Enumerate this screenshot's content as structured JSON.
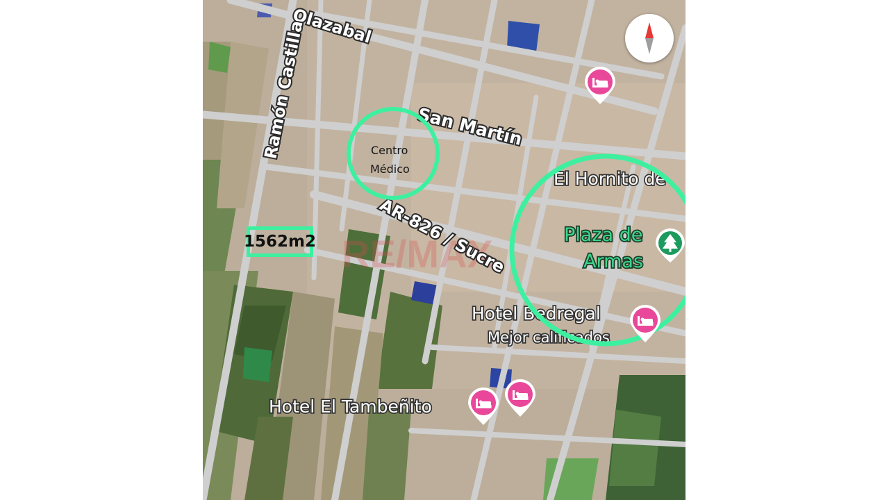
{
  "map": {
    "roads": {
      "top_street": "Olazabal",
      "left_street": "Ramón Castilla",
      "middle_street": "San Martín",
      "highway": "AR-826 / Sucre"
    },
    "places": {
      "medical_center_line1": "Centro",
      "medical_center_line2": "Médico",
      "restaurant": "El Hornito de",
      "plaza_line1": "Plaza de",
      "plaza_line2": "Armas",
      "hotel_bedregal": "Hotel Bedregal",
      "hotel_bedregal_sub": "Mejor calificados",
      "hotel_tambenito": "Hotel El Tambeñito"
    },
    "plot_area": "1562m2",
    "watermark": "RE/MAX",
    "icons": {
      "compass": "compass-icon",
      "hotel": "bed-icon",
      "park": "tree-icon"
    },
    "colors": {
      "highlight": "#3df0a0",
      "hotel_pin": "#e9489a",
      "park_pin": "#1d9a5e",
      "label_green": "#3cd68a"
    }
  }
}
